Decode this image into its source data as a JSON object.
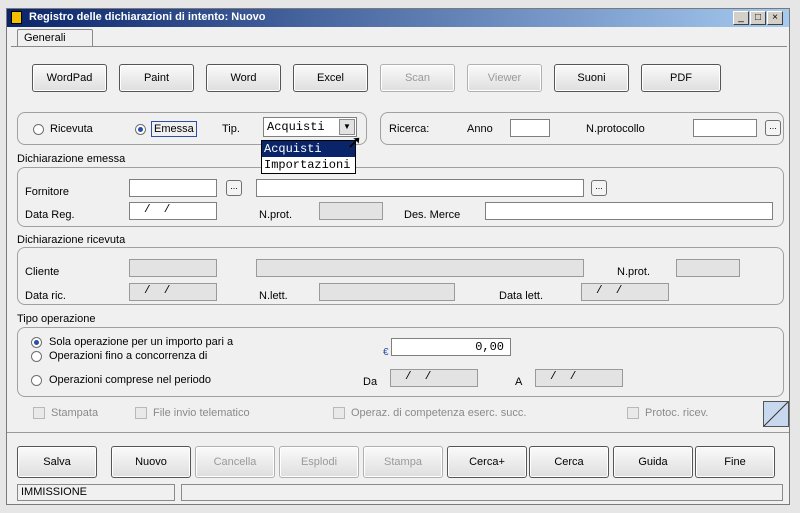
{
  "window": {
    "title": "Registro delle dichiarazioni di intento: Nuovo",
    "tab": "Generali"
  },
  "toolbar": [
    "WordPad",
    "Paint",
    "Word",
    "Excel",
    "Scan",
    "Viewer",
    "Suoni",
    "PDF"
  ],
  "toolbar_disabled": [
    "Scan",
    "Viewer"
  ],
  "filter": {
    "ricevuta": "Ricevuta",
    "emessa": "Emessa",
    "tip_label": "Tip.",
    "tip_value": "Acquisti",
    "tip_options": [
      "Acquisti",
      "Importazioni"
    ],
    "ricerca": "Ricerca:",
    "anno": "Anno",
    "nprotocollo": "N.protocollo",
    "selected": "Emessa"
  },
  "emessa": {
    "section": "Dichiarazione emessa",
    "fornitore": "Fornitore",
    "data_reg": "Data Reg.",
    "data_reg_value": "/  /",
    "nprot": "N.prot.",
    "des_merce": "Des. Merce"
  },
  "ricevuta": {
    "section": "Dichiarazione ricevuta",
    "cliente": "Cliente",
    "nprot": "N.prot.",
    "data_ric": "Data ric.",
    "data_ric_value": "/  /",
    "nlett": "N.lett.",
    "data_lett": "Data lett.",
    "data_lett_value": "/  /"
  },
  "tipo": {
    "section": "Tipo operazione",
    "opt1": "Sola operazione per un importo pari a",
    "opt2": "Operazioni fino a concorrenza di",
    "opt3": "Operazioni comprese nel periodo",
    "currency": "€",
    "importo": "0,00",
    "da": "Da",
    "da_value": "/  /",
    "a": "A",
    "a_value": "/  /",
    "selected": "Sola operazione per un importo pari a"
  },
  "checkboxes": [
    "Stampata",
    "File invio telematico",
    "Operaz. di competenza eserc. succ.",
    "Protoc. ricev."
  ],
  "actions": [
    "Salva",
    "Nuovo",
    "Cancella",
    "Esplodi",
    "Stampa",
    "Cerca+",
    "Cerca",
    "Guida",
    "Fine"
  ],
  "actions_disabled": [
    "Cancella",
    "Esplodi",
    "Stampa"
  ],
  "status": {
    "mode": "IMMISSIONE",
    "message": ""
  },
  "colors": {
    "titlebar": "#0a246a",
    "selection": "#0a246a",
    "accent": "#2b4fa8"
  }
}
